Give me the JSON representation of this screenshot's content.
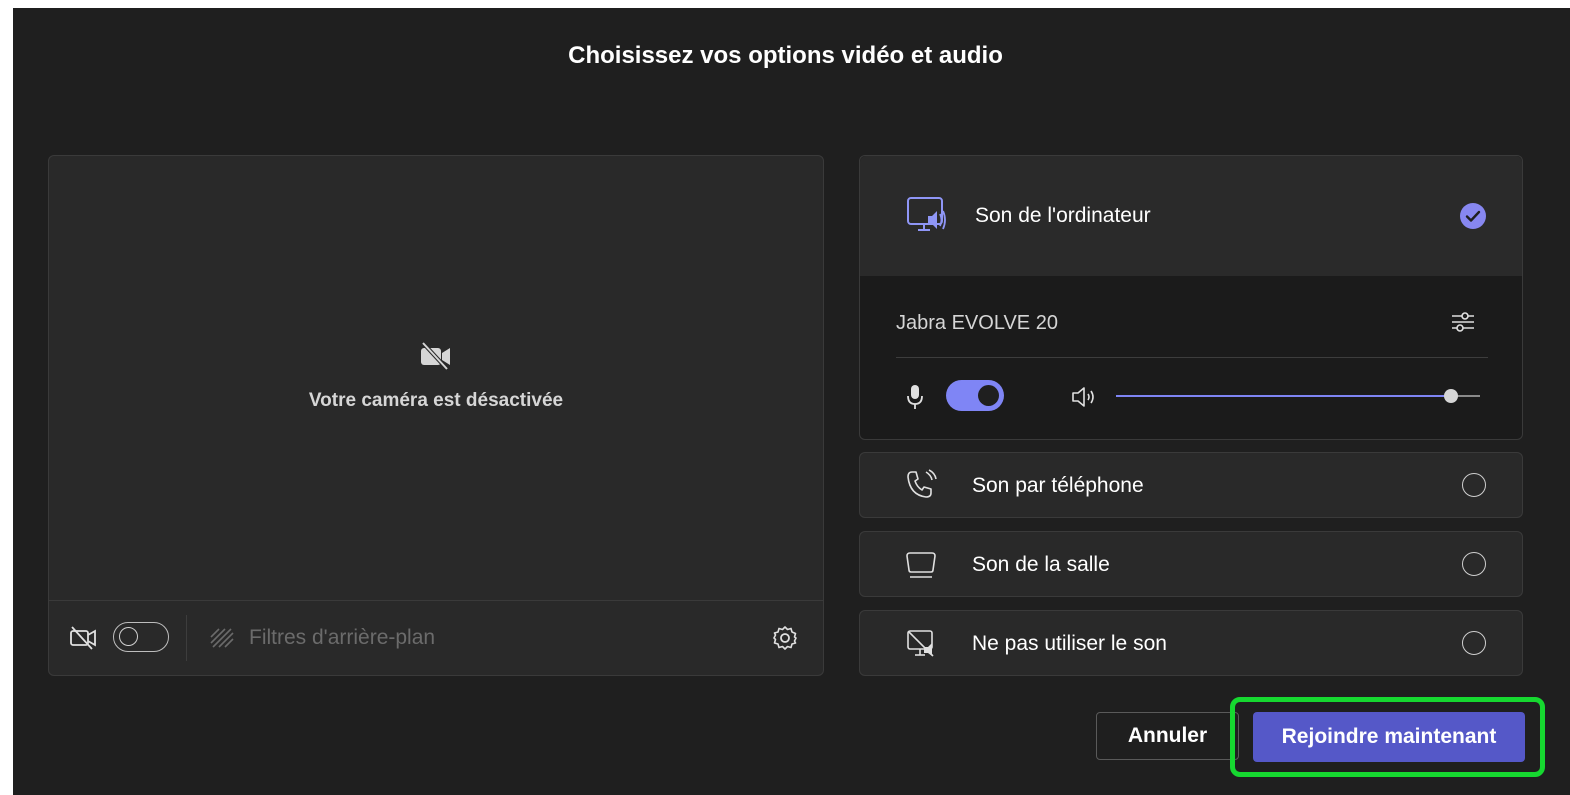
{
  "title": "Choisissez vos options vidéo et audio",
  "camera": {
    "off_text": "Votre caméra est désactivée",
    "toggle_on": false,
    "background_filters_label": "Filtres d'arrière-plan"
  },
  "audio": {
    "computer": {
      "label": "Son de l'ordinateur",
      "selected": true,
      "device_name": "Jabra EVOLVE 20",
      "mic_on": true,
      "speaker_volume": 0.92
    },
    "phone": {
      "label": "Son par téléphone",
      "selected": false
    },
    "room": {
      "label": "Son de la salle",
      "selected": false
    },
    "none": {
      "label": "Ne pas utiliser le son",
      "selected": false
    }
  },
  "buttons": {
    "cancel": "Annuler",
    "join": "Rejoindre maintenant"
  },
  "colors": {
    "accent": "#7f85f5",
    "join_button": "#5558c8",
    "highlight": "#16d830",
    "background": "#1f1f1f"
  }
}
